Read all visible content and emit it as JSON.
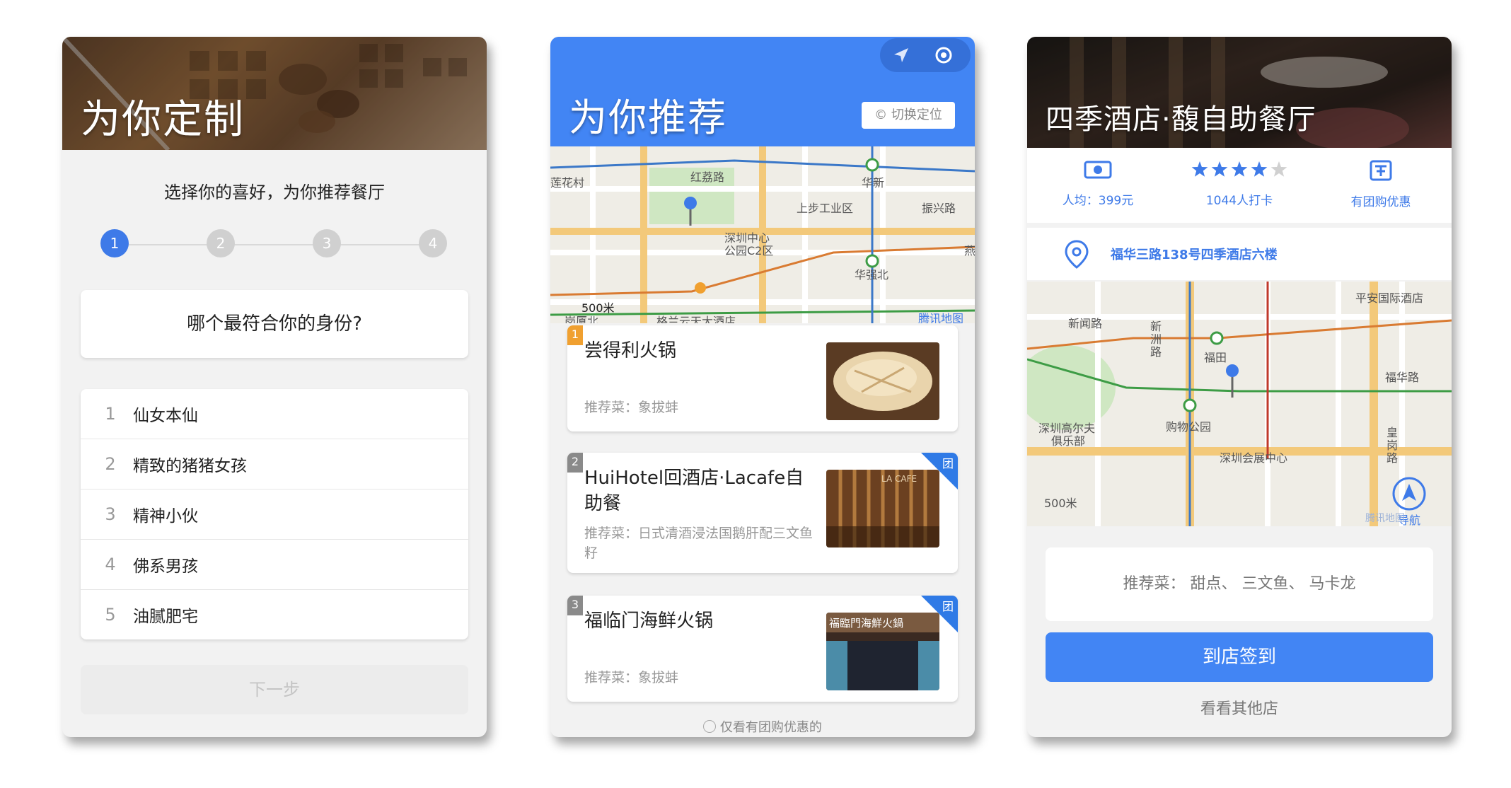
{
  "screen1": {
    "title": "为你定制",
    "subtitle": "选择你的喜好，为你推荐餐厅",
    "steps": [
      "1",
      "2",
      "3",
      "4"
    ],
    "active_step": 1,
    "question": "哪个最符合你的身份?",
    "options": [
      {
        "num": "1",
        "label": "仙女本仙"
      },
      {
        "num": "2",
        "label": "精致的猪猪女孩"
      },
      {
        "num": "3",
        "label": "精神小伙"
      },
      {
        "num": "4",
        "label": "佛系男孩"
      },
      {
        "num": "5",
        "label": "油腻肥宅"
      }
    ],
    "next_label": "下一步"
  },
  "screen2": {
    "title": "为你推荐",
    "switch_location": "© 切换定位",
    "map_labels": {
      "l1": "莲花村",
      "l2": "红荔路",
      "l3": "华新",
      "l4": "上步工业区",
      "l5": "振兴路",
      "l6": "深圳中心",
      "l7": "公园C2区",
      "l8": "华强北",
      "l9": "燕",
      "l10": "500米",
      "l11": "岗厦北",
      "l12": "格兰云天大酒店",
      "l13": "腾讯地图"
    },
    "restaurants": [
      {
        "rank": "1",
        "name": "尝得利火锅",
        "dish": "推荐菜：象拔蚌",
        "group_buy": false
      },
      {
        "rank": "2",
        "name": "HuiHotel回酒店·Lacafe自助餐",
        "dish": "推荐菜：日式清酒浸法国鹅肝配三文鱼籽",
        "group_buy": true,
        "group_label": "团"
      },
      {
        "rank": "3",
        "name": "福临门海鲜火锅",
        "dish": "推荐菜：象拔蚌",
        "group_buy": true,
        "group_label": "团",
        "sign_text": "福臨門海鮮火鍋"
      }
    ],
    "thumb2_text": "LA CAFE",
    "filter_label": "仅看有团购优惠的"
  },
  "screen3": {
    "title": "四季酒店·馥自助餐厅",
    "avg_price": "人均：399元",
    "rating": 4,
    "rating_max": 5,
    "checkins": "1044人打卡",
    "group_buy": "有团购优惠",
    "address": "福华三路138号四季酒店六楼",
    "map_labels": {
      "m1": "平安国际酒店",
      "m2": "新闻路",
      "m3": "新",
      "m4": "洲",
      "m5": "路",
      "m6": "福田",
      "m7": "福华路",
      "m8": "深圳高尔夫",
      "m9": "俱乐部",
      "m10": "购物公园",
      "m11": "皇",
      "m12": "岗",
      "m13": "路",
      "m14": "深圳会展中心",
      "m15": "500米",
      "m16": "导航",
      "m17": "腾讯地图"
    },
    "recommended": "推荐菜：  甜点、  三文鱼、  马卡龙",
    "checkin_label": "到店签到",
    "other_label": "看看其他店"
  },
  "colors": {
    "accent": "#4285f4",
    "group_tag": "#2f7ae6",
    "rank_orange": "#f0a030",
    "rank_gray": "#8a8a8a",
    "star": "#3e7ae8"
  },
  "icons": {
    "navigate": "navigate-arrow-icon",
    "locate": "target-icon",
    "price": "money-icon",
    "group": "group-buy-icon",
    "pin": "map-pin-icon"
  }
}
